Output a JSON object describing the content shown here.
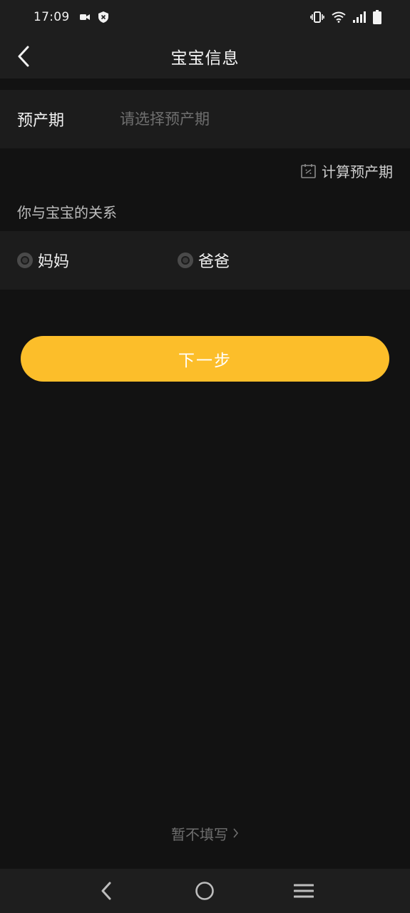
{
  "status_bar": {
    "time": "17:09",
    "left_icons": [
      "video-icon",
      "shield-icon"
    ],
    "right_icons": [
      "vibrate-icon",
      "wifi-icon",
      "signal-icon",
      "battery-icon"
    ]
  },
  "header": {
    "title": "宝宝信息",
    "back_icon": "chevron-left-icon"
  },
  "due_date": {
    "label": "预产期",
    "value": "",
    "placeholder": "请选择预产期"
  },
  "calculate": {
    "icon": "calendar-icon",
    "label": "计算预产期"
  },
  "relation": {
    "title": "你与宝宝的关系",
    "options": [
      {
        "label": "妈妈",
        "selected": false
      },
      {
        "label": "爸爸",
        "selected": false
      }
    ]
  },
  "next_button": {
    "label": "下一步"
  },
  "skip": {
    "label": "暂不填写",
    "icon": "chevron-right-icon"
  },
  "nav_bar": {
    "items": [
      "back-icon",
      "home-icon",
      "menu-icon"
    ]
  },
  "colors": {
    "background": "#121212",
    "surface": "#1c1c1c",
    "accent": "#fcbe2a",
    "placeholder": "#6f6f6f"
  }
}
